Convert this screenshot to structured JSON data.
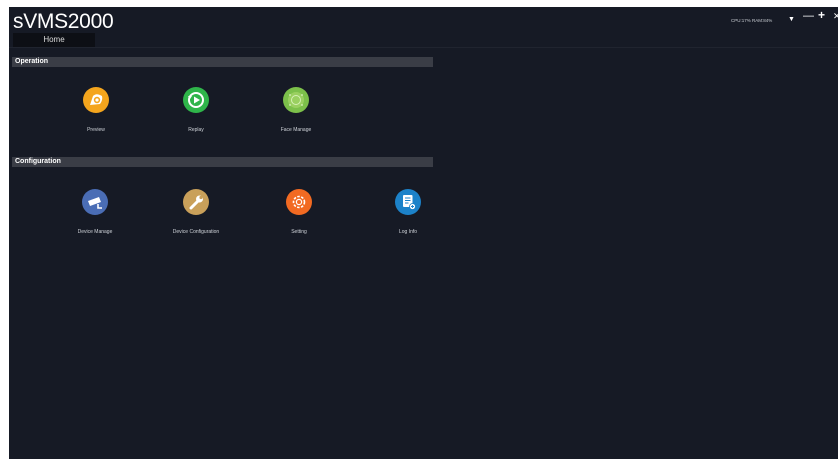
{
  "app": {
    "title": "sVMS2000",
    "home_tab": "Home",
    "status": "CPU:17%  RAM:84%"
  },
  "window_controls": {
    "dropdown_icon": "caret-down-icon",
    "minimize_icon": "minus-icon",
    "add_icon": "plus-icon",
    "close_icon": "close-icon"
  },
  "sections": {
    "operation": {
      "title": "Operation",
      "items": [
        {
          "label": "Preview",
          "icon": "preview-icon",
          "color": "#f4a51d"
        },
        {
          "label": "Replay",
          "icon": "replay-icon",
          "color": "#2fb54a"
        },
        {
          "label": "Face Manage",
          "icon": "face-manage-icon",
          "color": "#7cc04a"
        }
      ]
    },
    "configuration": {
      "title": "Configuration",
      "items": [
        {
          "label": "Device Manage",
          "icon": "camera-icon",
          "color": "#4a6db5"
        },
        {
          "label": "Device Configuration",
          "icon": "wrench-icon",
          "color": "#c9a05a"
        },
        {
          "label": "Setting",
          "icon": "gear-icon",
          "color": "#f26a22"
        },
        {
          "label": "Log Info",
          "icon": "log-icon",
          "color": "#1c82c9"
        }
      ]
    }
  },
  "colors": {
    "background": "#161a25",
    "section_header": "#3a3d46",
    "brand_underline": "#36c23b"
  }
}
